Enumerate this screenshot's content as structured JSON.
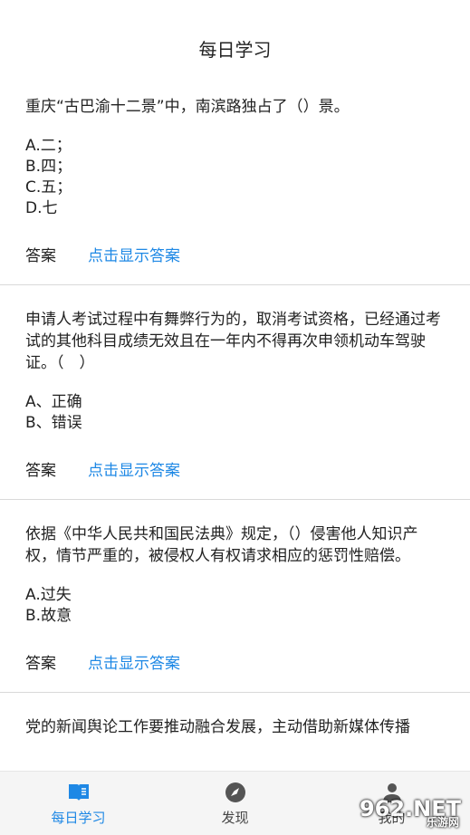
{
  "header": {
    "title": "每日学习"
  },
  "answer_label": "答案",
  "show_answer_label": "点击显示答案",
  "questions": [
    {
      "text": "重庆“古巴渝十二景”中，南滨路独占了（）景。",
      "options": [
        "A.二；",
        "B.四；",
        "C.五；",
        "D.七"
      ]
    },
    {
      "text": "申请人考试过程中有舞弊行为的，取消考试资格，已经通过考试的其他科目成绩无效且在一年内不得再次申领机动车驾驶证。（　）",
      "options": [
        "A、正确",
        "B、错误"
      ]
    },
    {
      "text": "依据《中华人民共和国民法典》规定，（）侵害他人知识产权，情节严重的，被侵权人有权请求相应的惩罚性赔偿。",
      "options": [
        "A.过失",
        "B.故意"
      ]
    },
    {
      "text": "党的新闻舆论工作要推动融合发展，主动借助新媒体传播"
    }
  ],
  "tabbar": {
    "items": [
      {
        "label": "每日学习",
        "icon": "book-icon",
        "active": true
      },
      {
        "label": "发现",
        "icon": "compass-icon",
        "active": false
      },
      {
        "label": "我的",
        "icon": "person-icon",
        "active": false
      }
    ]
  },
  "watermark": {
    "main": "962.NET",
    "sub": "乐游网"
  },
  "colors": {
    "accent": "#1e88e5",
    "text": "#222222",
    "divider": "#d9d9d9",
    "tabbar_bg": "#f5f5f5"
  }
}
